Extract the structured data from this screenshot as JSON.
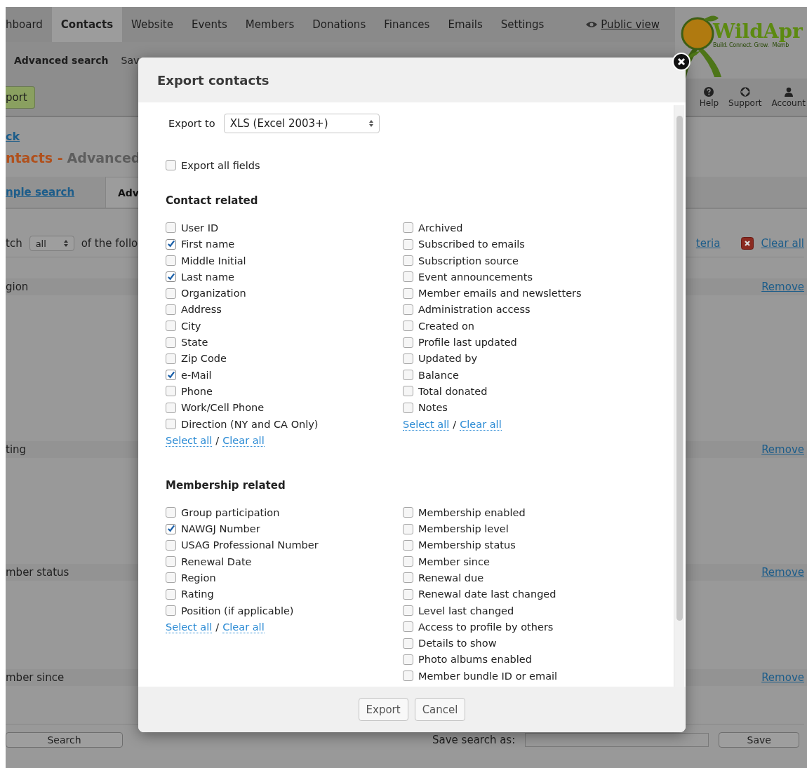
{
  "nav": {
    "tabs": [
      {
        "label": "hboard",
        "selected": false
      },
      {
        "label": "Contacts",
        "selected": true
      },
      {
        "label": "Website",
        "selected": false
      },
      {
        "label": "Events",
        "selected": false
      },
      {
        "label": "Members",
        "selected": false
      },
      {
        "label": "Donations",
        "selected": false
      },
      {
        "label": "Finances",
        "selected": false
      },
      {
        "label": "Emails",
        "selected": false
      },
      {
        "label": "Settings",
        "selected": false
      }
    ],
    "public_view": "Public view"
  },
  "logo": {
    "name": "WildApr",
    "tagline": "Build. Connect. Grow.",
    "tagline_2": "Memb"
  },
  "subnav": {
    "title": "Advanced search",
    "item": "Sav"
  },
  "toolbar": {
    "button": "port",
    "actions": [
      {
        "kind": "help",
        "label": "Help"
      },
      {
        "kind": "support",
        "label": "Support"
      },
      {
        "kind": "account",
        "label": "Account"
      }
    ]
  },
  "page": {
    "back_link": "ck",
    "title_prefix": "ntacts -",
    "title": "Advanced",
    "search_tabs": [
      {
        "label": "nple search",
        "selected": false
      },
      {
        "label": "Adv",
        "selected": true
      }
    ],
    "match": {
      "prefix": "tch",
      "value": "all",
      "suffix": "of the follo"
    },
    "criteria_link": "teria",
    "clear_all": "Clear all",
    "criteria": [
      {
        "label": "gion",
        "remove": "Remove"
      },
      {
        "label": "ting",
        "remove": "Remove"
      },
      {
        "label": "mber status",
        "remove": "Remove"
      },
      {
        "label": "mber since",
        "remove": "Remove"
      }
    ],
    "search_button": "Search",
    "save_label": "Save search as:",
    "save_button": "Save"
  },
  "modal": {
    "title": "Export contacts",
    "export_to_label": "Export to",
    "export_to_value": "XLS (Excel 2003+)",
    "export_all": {
      "label": "Export all fields",
      "checked": false
    },
    "sections": [
      {
        "title": "Contact related",
        "columns": [
          {
            "items": [
              {
                "label": "User ID",
                "checked": false
              },
              {
                "label": "First name",
                "checked": true
              },
              {
                "label": "Middle Initial",
                "checked": false
              },
              {
                "label": "Last name",
                "checked": true
              },
              {
                "label": "Organization",
                "checked": false
              },
              {
                "label": "Address",
                "checked": false
              },
              {
                "label": "City",
                "checked": false
              },
              {
                "label": "State",
                "checked": false
              },
              {
                "label": "Zip Code",
                "checked": false
              },
              {
                "label": "e-Mail",
                "checked": true
              },
              {
                "label": "Phone",
                "checked": false
              },
              {
                "label": "Work/Cell Phone",
                "checked": false
              },
              {
                "label": "Direction (NY and CA Only)",
                "checked": false
              }
            ],
            "select_all": "Select all",
            "separator": "/",
            "clear_all": "Clear all"
          },
          {
            "items": [
              {
                "label": "Archived",
                "checked": false
              },
              {
                "label": "Subscribed to emails",
                "checked": false
              },
              {
                "label": "Subscription source",
                "checked": false
              },
              {
                "label": "Event announcements",
                "checked": false
              },
              {
                "label": "Member emails and newsletters",
                "checked": false
              },
              {
                "label": "Administration access",
                "checked": false
              },
              {
                "label": "Created on",
                "checked": false
              },
              {
                "label": "Profile last updated",
                "checked": false
              },
              {
                "label": "Updated by",
                "checked": false
              },
              {
                "label": "Balance",
                "checked": false
              },
              {
                "label": "Total donated",
                "checked": false
              },
              {
                "label": "Notes",
                "checked": false
              }
            ],
            "select_all": "Select all",
            "separator": "/",
            "clear_all": "Clear all"
          }
        ]
      },
      {
        "title": "Membership related",
        "columns": [
          {
            "items": [
              {
                "label": "Group participation",
                "checked": false
              },
              {
                "label": "NAWGJ Number",
                "checked": true
              },
              {
                "label": "USAG Professional Number",
                "checked": false
              },
              {
                "label": "Renewal Date",
                "checked": false
              },
              {
                "label": "Region",
                "checked": false
              },
              {
                "label": "Rating",
                "checked": false
              },
              {
                "label": "Position (if applicable)",
                "checked": false
              }
            ],
            "select_all": "Select all",
            "separator": "/",
            "clear_all": "Clear all"
          },
          {
            "items": [
              {
                "label": "Membership enabled",
                "checked": false
              },
              {
                "label": "Membership level",
                "checked": false
              },
              {
                "label": "Membership status",
                "checked": false
              },
              {
                "label": "Member since",
                "checked": false
              },
              {
                "label": "Renewal due",
                "checked": false
              },
              {
                "label": "Renewal date last changed",
                "checked": false
              },
              {
                "label": "Level last changed",
                "checked": false
              },
              {
                "label": "Access to profile by others",
                "checked": false
              },
              {
                "label": "Details to show",
                "checked": false
              },
              {
                "label": "Photo albums enabled",
                "checked": false
              },
              {
                "label": "Member bundle ID or email",
                "checked": false
              }
            ]
          }
        ]
      }
    ],
    "buttons": [
      "Export",
      "Cancel"
    ]
  }
}
